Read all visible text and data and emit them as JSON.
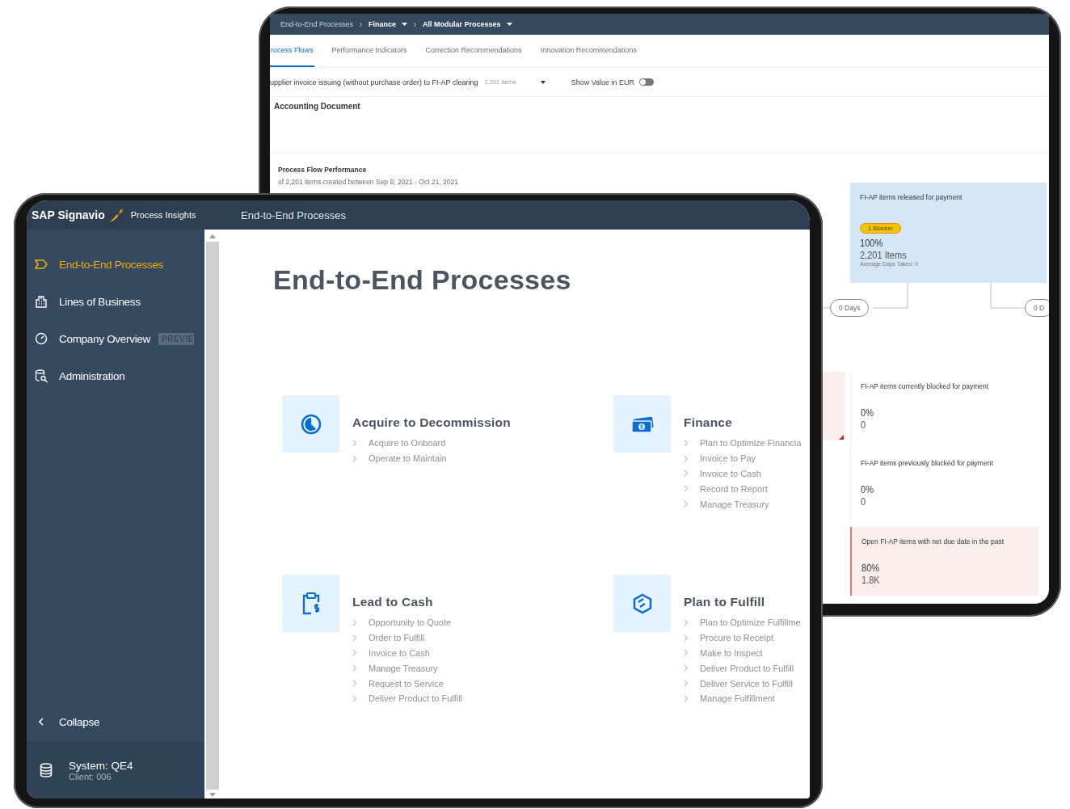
{
  "back_screen": {
    "breadcrumb": [
      {
        "label": "End-to-End Processes",
        "dropdown": false
      },
      {
        "label": "Finance",
        "dropdown": true
      },
      {
        "label": "All Modular Processes",
        "dropdown": true
      }
    ],
    "tabs": [
      {
        "label": "rocess Flows",
        "selected": true
      },
      {
        "label": "Performance Indicators",
        "selected": false
      },
      {
        "label": "Correction Recommendations",
        "selected": false
      },
      {
        "label": "Innovation Recommendations",
        "selected": false
      }
    ],
    "process_select": {
      "value": "upplier invoice issuing (without purchase order) to FI-AP clearing",
      "count": "2,201 Items"
    },
    "toggle": {
      "label": "Show Value in EUR",
      "on": false
    },
    "section_title": "Accounting Document",
    "performance": {
      "title": "Process Flow Performance",
      "subtitle": "of 2,201 items created between Sep 9, 2021 - Oct 21, 2021"
    },
    "flow": {
      "nodes": [
        {
          "kind": "highlighted",
          "title": "FI-AP items released for payment",
          "badge": "1 Blocker",
          "percent": "100%",
          "count": "2,201 Items",
          "note": "Average Days Taken: 0"
        },
        {
          "kind": "plain",
          "title": "FI-AP items currently blocked for payment",
          "percent": "0%",
          "count": "0"
        },
        {
          "kind": "plain",
          "title": "FI-AP items previously blocked for payment",
          "percent": "0%",
          "count": "0"
        },
        {
          "kind": "alert",
          "title": "Open FI-AP items with net due date in the past",
          "percent": "80%",
          "count": "1.8K"
        }
      ],
      "durations": [
        "0 Days",
        "0 D"
      ]
    }
  },
  "front_screen": {
    "brand": "SAP Signavio",
    "product": "Process Insights",
    "page_title": "End-to-End Processes",
    "sidebar": {
      "items": [
        {
          "label": "End-to-End Processes",
          "selected": true
        },
        {
          "label": "Lines of Business",
          "selected": false
        },
        {
          "label": "Company Overview",
          "selected": false,
          "badge": "PREVIE"
        },
        {
          "label": "Administration",
          "selected": false
        }
      ],
      "collapse": "Collapse",
      "system": "System: QE4",
      "client": "Client: 006"
    },
    "heading": "End-to-End Processes",
    "groups": [
      {
        "title": "Acquire to Decommission",
        "children": [
          "Acquire to Onboard",
          "Operate to Maintain"
        ]
      },
      {
        "title": "Finance",
        "children": [
          "Plan to Optimize Financia",
          "Invoice to Pay",
          "Invoice to Cash",
          "Record to Report",
          "Manage Treasury"
        ]
      },
      {
        "title": "Lead to Cash",
        "children": [
          "Opportunity to Quote",
          "Order to Fulfill",
          "Invoice to Cash",
          "Manage Treasury",
          "Request to Service",
          "Deliver Product to Fulfill"
        ]
      },
      {
        "title": "Plan to Fulfill",
        "children": [
          "Plan to Optimize Fulfillme",
          "Procure to Receipt",
          "Make to Inspect",
          "Deliver Product to Fulfill",
          "Deliver Service to Fulfill",
          "Manage Fulfillment"
        ]
      }
    ]
  }
}
